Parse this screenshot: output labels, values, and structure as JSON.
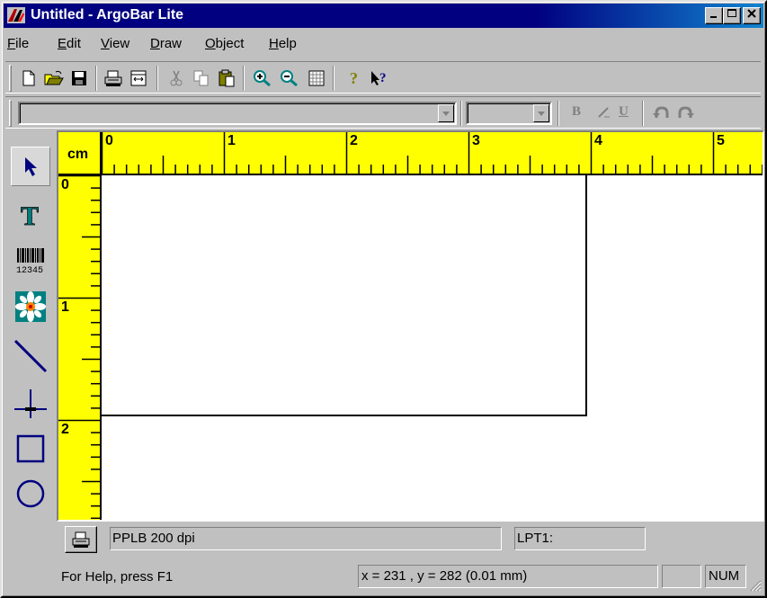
{
  "window": {
    "title": "Untitled - ArgoBar Lite"
  },
  "title_buttons": {
    "minimize": "_",
    "maximize": "□",
    "close": "×"
  },
  "menu": {
    "items": [
      {
        "label": "File",
        "key": "F",
        "rest": "ile"
      },
      {
        "label": "Edit",
        "key": "E",
        "rest": "dit"
      },
      {
        "label": "View",
        "key": "V",
        "rest": "iew"
      },
      {
        "label": "Draw",
        "key": "D",
        "rest": "raw"
      },
      {
        "label": "Object",
        "key": "O",
        "rest": "bject"
      },
      {
        "label": "Help",
        "key": "H",
        "rest": "elp"
      }
    ]
  },
  "toolbar": {
    "buttons": [
      "new-file-icon",
      "open-folder-icon",
      "save-icon",
      "print-icon",
      "page-setup-icon",
      "cut-icon",
      "copy-icon",
      "paste-icon",
      "zoom-in-icon",
      "zoom-out-icon",
      "grid-icon",
      "help-icon",
      "context-help-icon"
    ]
  },
  "format_bar": {
    "font_name": "",
    "font_size": "",
    "bold_label": "B",
    "italic_label": "I",
    "underline_label": "U"
  },
  "tools": [
    "select-arrow-icon",
    "text-tool-icon",
    "barcode-tool-icon",
    "image-tool-icon",
    "line-tool-icon",
    "crosshair-tool-icon",
    "rectangle-tool-icon",
    "ellipse-tool-icon"
  ],
  "barcode_tool_digits": "12345",
  "ruler": {
    "unit": "cm",
    "h_labels": [
      "0",
      "1",
      "2",
      "3",
      "4",
      "5"
    ],
    "v_labels": [
      "0",
      "1",
      "2"
    ]
  },
  "printer": {
    "model": "PPLB 200 dpi",
    "port": "LPT1:"
  },
  "status": {
    "help_text": "For Help, press F1",
    "coords": "x = 231 , y = 282  (0.01 mm)",
    "empty_panel": "",
    "num_indicator": "NUM"
  },
  "colors": {
    "titlebar": "#000080",
    "ruler": "#ffff00",
    "face": "#c0c0c0"
  }
}
